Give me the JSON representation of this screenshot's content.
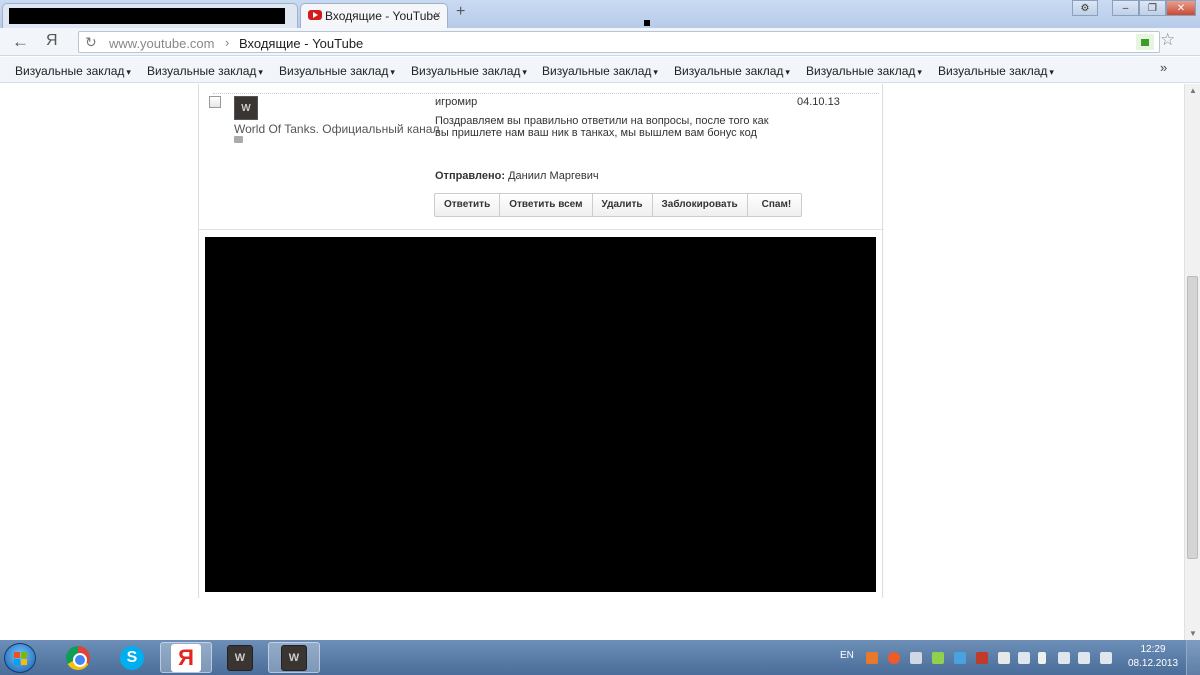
{
  "browser": {
    "tabs": [
      {
        "title": ""
      },
      {
        "title": "Входящие - YouTube",
        "close": "×"
      }
    ],
    "new_tab": "+",
    "window_buttons": {
      "settings": "⚙",
      "minimize": "–",
      "restore": "❐",
      "close": "✕"
    },
    "nav": {
      "back": "←",
      "yandex": "Я",
      "reload": "↻"
    },
    "address": {
      "host": "www.youtube.com",
      "separator": "›",
      "page_title": "Входящие - YouTube"
    },
    "star": "☆",
    "bookmarks": [
      {
        "label": "Визуальные заклад"
      },
      {
        "label": "Визуальные заклад"
      },
      {
        "label": "Визуальные заклад"
      },
      {
        "label": "Визуальные заклад"
      },
      {
        "label": "Визуальные заклад"
      },
      {
        "label": "Визуальные заклад"
      },
      {
        "label": "Визуальные заклад"
      },
      {
        "label": "Визуальные заклад"
      }
    ],
    "bookmark_dropdown": "▾",
    "bookmarks_more": "»"
  },
  "message": {
    "sender": "World Of Tanks. Официальный канал",
    "avatar_text": "W",
    "subject": "игромир",
    "date": "04.10.13",
    "body": "Поздравляем вы правильно ответили на вопросы, после того как вы пришлете нам ваш ник в танках, мы вышлем вам бонус код",
    "sent_label": "Отправлено:",
    "sent_to": "Даниил Маргевич",
    "actions": {
      "reply": "Ответить",
      "reply_all": "Ответить всем",
      "delete": "Удалить",
      "block": "Заблокировать",
      "spam": "Спам!"
    }
  },
  "scrollbar": {
    "up": "▲",
    "down": "▼"
  },
  "taskbar": {
    "apps": [
      "chrome",
      "skype",
      "yandex-browser",
      "world-of-tanks",
      "world-of-tanks"
    ],
    "skype_letter": "S",
    "yandex_letter": "Я",
    "wot_letter": "W",
    "language": "EN",
    "clock_time": "12:29",
    "clock_date": "08.12.2013"
  }
}
